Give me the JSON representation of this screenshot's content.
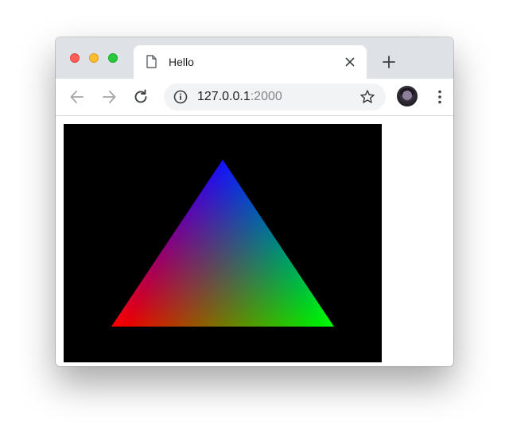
{
  "window": {
    "traffic_lights": [
      "close",
      "minimize",
      "maximize"
    ]
  },
  "tab": {
    "title": "Hello",
    "icon": "document-icon",
    "close_icon": "close-icon"
  },
  "new_tab_icon": "plus-icon",
  "toolbar": {
    "back_icon": "arrow-left-icon",
    "forward_icon": "arrow-right-icon",
    "reload_icon": "reload-icon",
    "menu_icon": "kebab-menu-icon"
  },
  "omnibox": {
    "url_host": "127.0.0.1",
    "url_port": ":2000",
    "info_icon": "info-icon",
    "bookmark_icon": "star-icon"
  },
  "profile": {
    "avatar": "profile-avatar"
  },
  "canvas": {
    "background": "#000000",
    "triangle_vertex_colors": {
      "top": "#0000ff",
      "bottom_left": "#ff0000",
      "bottom_right": "#00ff00"
    }
  }
}
